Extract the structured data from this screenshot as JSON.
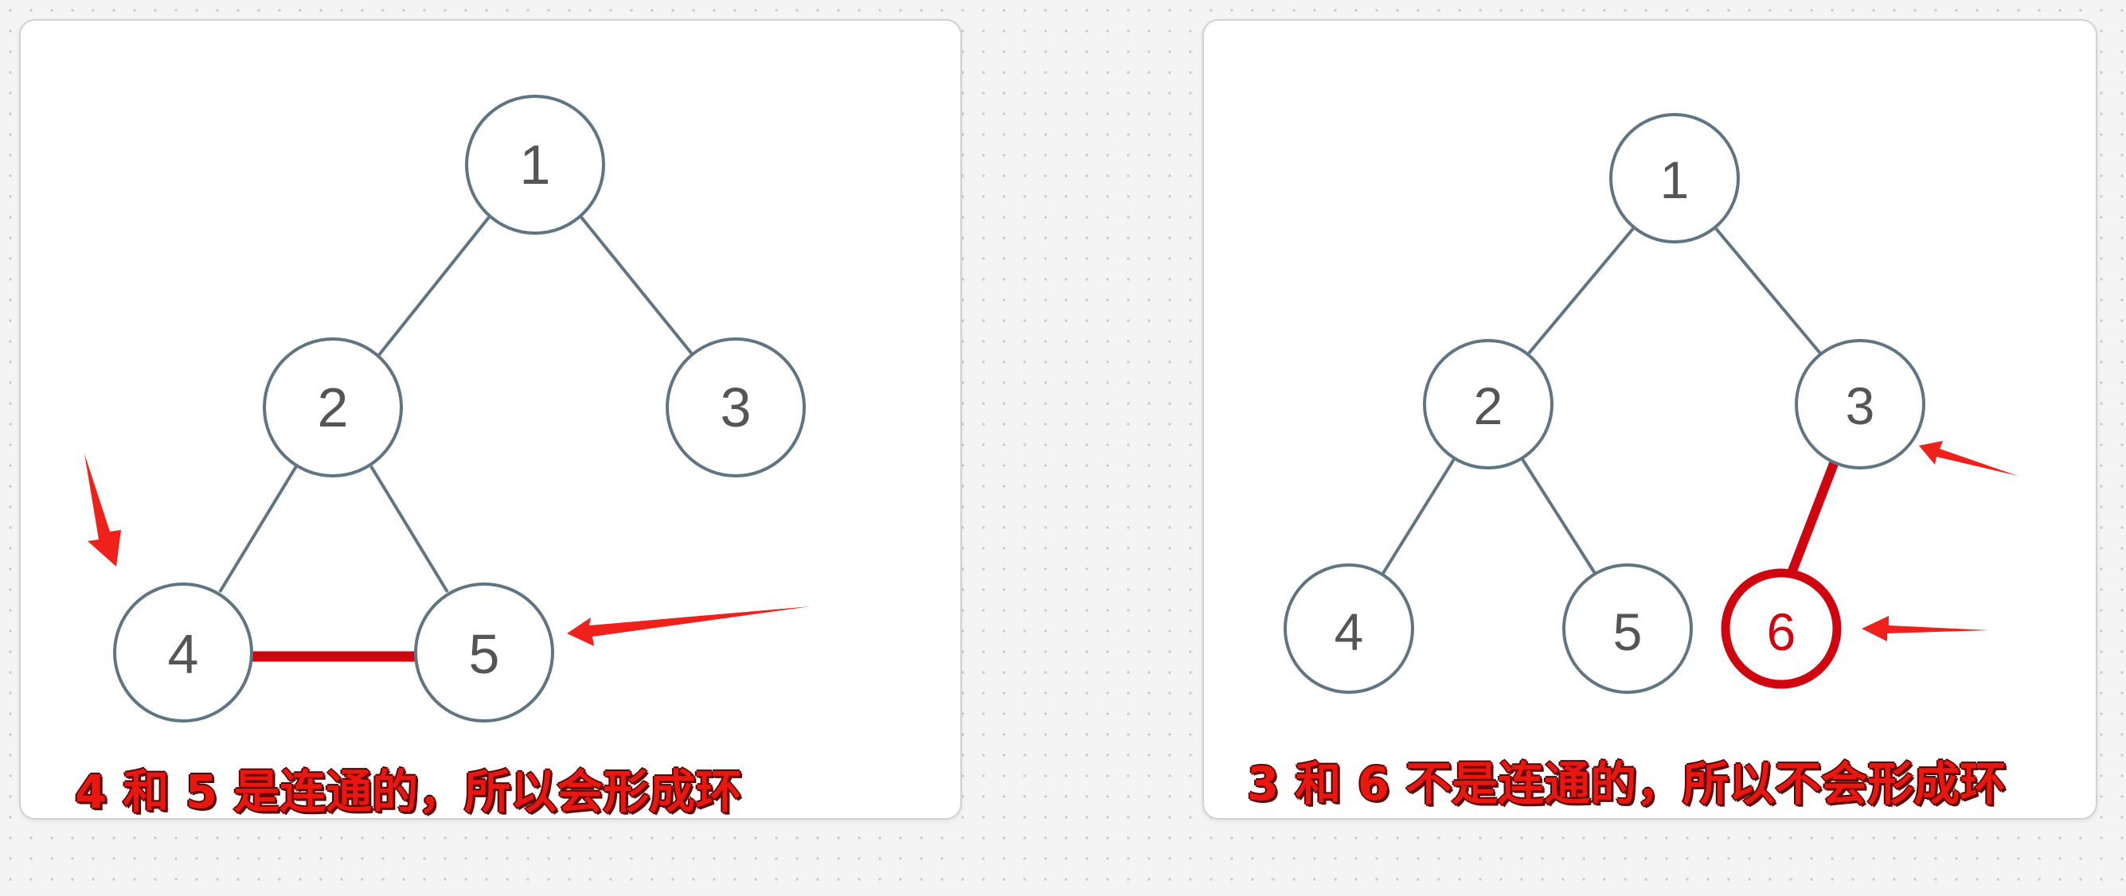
{
  "colors": {
    "edge": "#5f7583",
    "node_stroke": "#5f7583",
    "node_text": "#555555",
    "highlight": "#d1050f",
    "arrow": "#f0201a",
    "caption": "#e8170f"
  },
  "diagrams": {
    "left": {
      "nodes": [
        "1",
        "2",
        "3",
        "4",
        "5"
      ],
      "caption": "4 和 5 是连通的，所以会形成环"
    },
    "right": {
      "nodes": [
        "1",
        "2",
        "3",
        "4",
        "5",
        "6"
      ],
      "caption": "3 和 6 不是连通的，所以不会形成环"
    }
  }
}
